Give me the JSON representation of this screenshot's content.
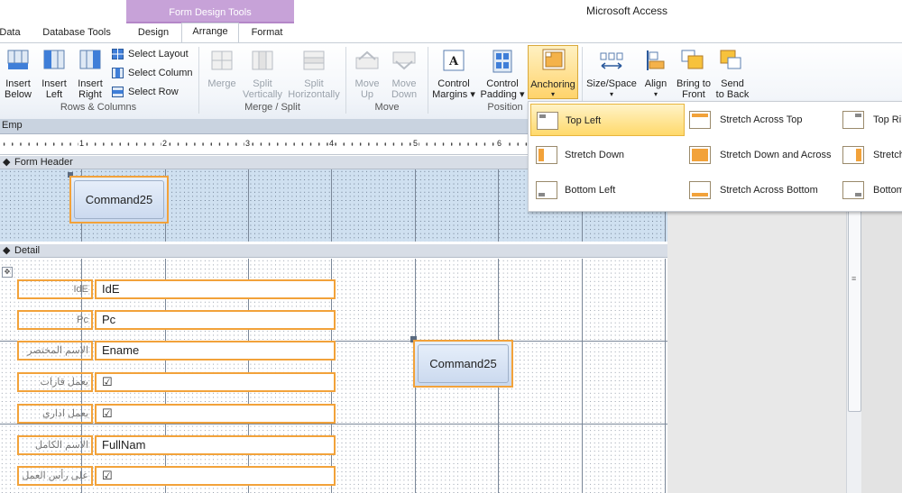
{
  "app_title": "Microsoft Access",
  "context_tab_group": "Form Design Tools",
  "tabs": [
    "Data",
    "Database Tools",
    "Design",
    "Arrange",
    "Format"
  ],
  "active_tab": "Arrange",
  "ribbon": {
    "rows_columns": {
      "buttons": [
        {
          "line1": "Insert",
          "line2": "Below"
        },
        {
          "line1": "Insert",
          "line2": "Left"
        },
        {
          "line1": "Insert",
          "line2": "Right"
        }
      ],
      "select": [
        "Select Layout",
        "Select Column",
        "Select Row"
      ],
      "label": "Rows & Columns"
    },
    "merge_split": {
      "buttons": [
        {
          "line1": "Merge",
          "line2": ""
        },
        {
          "line1": "Split",
          "line2": "Vertically"
        },
        {
          "line1": "Split",
          "line2": "Horizontally"
        }
      ],
      "label": "Merge / Split"
    },
    "move": {
      "buttons": [
        {
          "line1": "Move",
          "line2": "Up"
        },
        {
          "line1": "Move",
          "line2": "Down"
        }
      ],
      "label": "Move"
    },
    "position": {
      "buttons": [
        {
          "line1": "Control",
          "line2": "Margins ▾"
        },
        {
          "line1": "Control",
          "line2": "Padding ▾"
        },
        {
          "line1": "Anchoring",
          "line2": "▾"
        }
      ],
      "label": "Position"
    },
    "sizing": {
      "buttons": [
        {
          "line1": "Size/Space",
          "line2": "▾"
        },
        {
          "line1": "Align",
          "line2": "▾"
        },
        {
          "line1": "Bring to",
          "line2": "Front"
        },
        {
          "line1": "Send",
          "line2": "to Back"
        }
      ]
    }
  },
  "document_tab": "Emp",
  "ruler_numbers": [
    "1",
    "2",
    "3",
    "4",
    "5",
    "6"
  ],
  "sections": {
    "form_header": "Form Header",
    "detail": "Detail"
  },
  "header_button": "Command25",
  "detail_button": "Command25",
  "fields": [
    {
      "label": "IdE",
      "value": "IdE"
    },
    {
      "label": "Pc",
      "value": "Pc"
    },
    {
      "label": "الاسم المختصر",
      "value": "Ename"
    },
    {
      "label": "يعمل قارات",
      "value": "☑"
    },
    {
      "label": "يعمل اداري",
      "value": "☑"
    },
    {
      "label": "الاسم الكامل",
      "value": "FullNam"
    },
    {
      "label": "على رأس العمل",
      "value": "☑"
    }
  ],
  "anchoring_menu": {
    "items": [
      {
        "label": "Top Left",
        "selected": true
      },
      {
        "label": "Stretch Across Top",
        "selected": false
      },
      {
        "label": "Top Ri",
        "selected": false
      },
      {
        "label": "Stretch Down",
        "selected": false
      },
      {
        "label": "Stretch Down and Across",
        "selected": false
      },
      {
        "label": "Stretch",
        "selected": false
      },
      {
        "label": "Bottom Left",
        "selected": false
      },
      {
        "label": "Stretch Across Bottom",
        "selected": false
      },
      {
        "label": "Bottom",
        "selected": false
      }
    ]
  },
  "colors": {
    "selection_orange": "#f2a23a",
    "context_tab_purple": "#c7a2d8",
    "menu_highlight": "#ffd96b"
  }
}
